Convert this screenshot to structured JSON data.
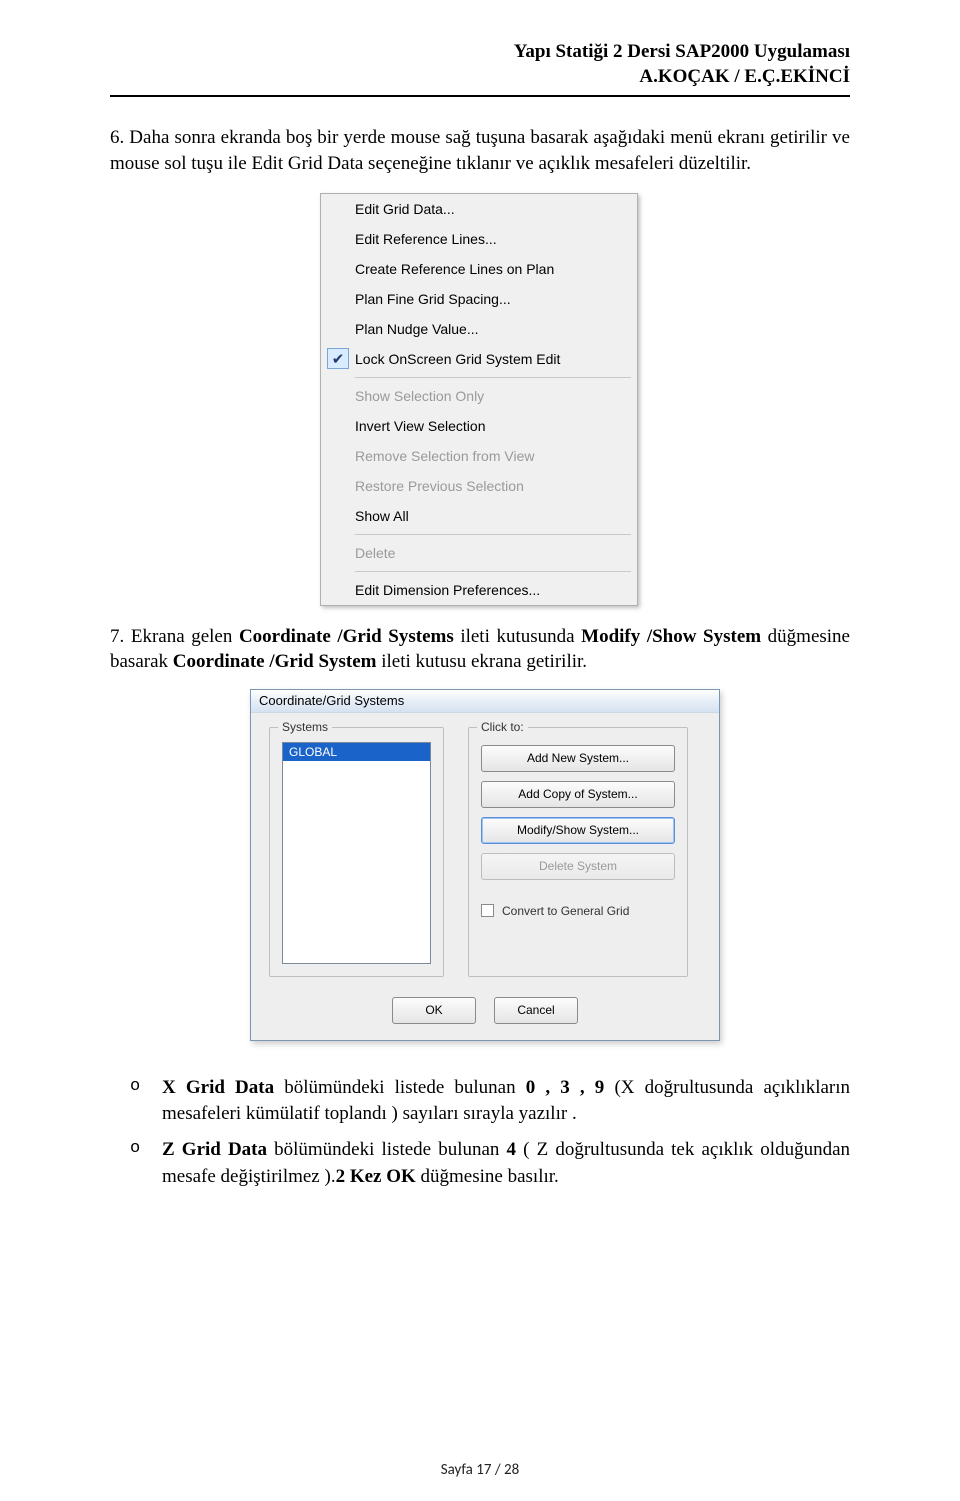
{
  "header": {
    "line1": "Yapı Statiği 2  Dersi SAP2000 Uygulaması",
    "line2": "A.KOÇAK / E.Ç.EKİNCİ"
  },
  "para1": {
    "plain_prefix": "6. Daha sonra ekranda boş bir yerde mouse sağ tuşuna basarak aşağıdaki menü ekranı getirilir ve mouse sol tuşu ile  Edit Grid Data seçeneğine  tıklanır ve açıklık mesafeleri düzeltilir."
  },
  "context_menu": {
    "items": [
      {
        "label": "Edit Grid Data...",
        "disabled": false,
        "checked": false
      },
      {
        "label": "Edit Reference Lines...",
        "disabled": false,
        "checked": false
      },
      {
        "label": "Create Reference Lines on Plan",
        "disabled": false,
        "checked": false
      },
      {
        "label": "Plan Fine Grid Spacing...",
        "disabled": false,
        "checked": false
      },
      {
        "label": "Plan Nudge Value...",
        "disabled": false,
        "checked": false
      },
      {
        "label": "Lock OnScreen Grid System Edit",
        "disabled": false,
        "checked": true
      },
      {
        "sep": true
      },
      {
        "label": "Show Selection Only",
        "disabled": true,
        "checked": false
      },
      {
        "label": "Invert View Selection",
        "disabled": false,
        "checked": false
      },
      {
        "label": "Remove Selection from View",
        "disabled": true,
        "checked": false
      },
      {
        "label": "Restore Previous Selection",
        "disabled": true,
        "checked": false
      },
      {
        "label": "Show All",
        "disabled": false,
        "checked": false
      },
      {
        "sep": true
      },
      {
        "label": "Delete",
        "disabled": true,
        "checked": false
      },
      {
        "sep": true
      },
      {
        "label": "Edit Dimension Preferences...",
        "disabled": false,
        "checked": false
      }
    ]
  },
  "para2_parts": {
    "a": "7. Ekrana gelen ",
    "b": "Coordinate /Grid Systems",
    "c": " ileti kutusunda ",
    "d": "Modify /Show System",
    "e": " düğmesine basarak ",
    "f": "Coordinate /Grid System",
    "g": " ileti kutusu ekrana getirilir."
  },
  "dialog": {
    "title": "Coordinate/Grid Systems",
    "systems_legend": "Systems",
    "click_legend": "Click to:",
    "list_item": "GLOBAL",
    "buttons": {
      "add_new": "Add New System...",
      "add_copy": "Add Copy of System...",
      "modify": "Modify/Show System...",
      "delete": "Delete System"
    },
    "checkbox": "Convert to General Grid",
    "ok": "OK",
    "cancel": "Cancel"
  },
  "bullets": {
    "b1": {
      "a": "X Grid Data",
      "b": " bölümündeki listede bulunan ",
      "c": "0 , 3 , 9 ",
      "d": "(X doğrultusunda açıklıkların mesafeleri kümülatif toplandı ) sayıları sırayla yazılır ."
    },
    "b2": {
      "a": "Z Grid Data",
      "b": " bölümündeki listede bulunan ",
      "c": "4 ",
      "d": "( Z doğrultusunda tek  açıklık olduğundan mesafe değiştirilmez ).",
      "e": "2 Kez OK",
      "f": " düğmesine basılır."
    }
  },
  "footer": "Sayfa 17 / 28"
}
